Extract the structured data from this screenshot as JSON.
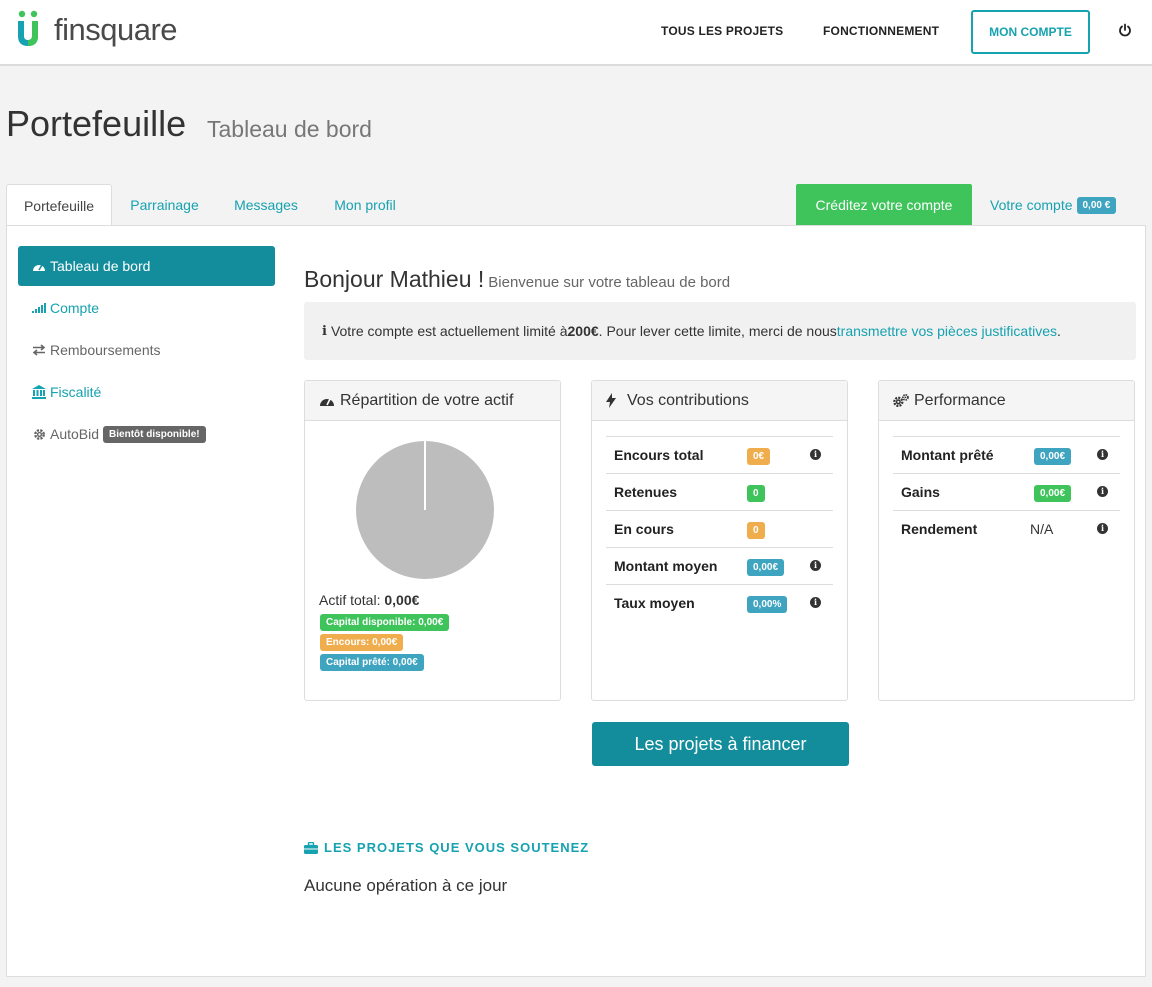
{
  "brand": {
    "name": "finsquare",
    "accent": "#16a2b0",
    "green": "#3ec45b",
    "orange": "#f0ad4e"
  },
  "nav": {
    "all_projects": "TOUS LES PROJETS",
    "how_it_works": "FONCTIONNEMENT",
    "my_account": "MON COMPTE",
    "logout_icon": "power-icon"
  },
  "page": {
    "title": "Portefeuille",
    "subtitle": "Tableau de bord"
  },
  "tabs": {
    "items": [
      {
        "label": "Portefeuille"
      },
      {
        "label": "Parrainage"
      },
      {
        "label": "Messages"
      },
      {
        "label": "Mon profil"
      }
    ],
    "credit": "Créditez votre compte",
    "account_label": "Votre compte",
    "account_balance": "0,00 €"
  },
  "sidebar": {
    "items": [
      {
        "label": "Tableau de bord",
        "icon": "dashboard-icon"
      },
      {
        "label": "Compte",
        "icon": "signal-icon"
      },
      {
        "label": "Remboursements",
        "icon": "exchange-icon"
      },
      {
        "label": "Fiscalité",
        "icon": "bank-icon"
      },
      {
        "label": "AutoBid",
        "icon": "gear-icon",
        "badge": "Bientôt disponible!"
      }
    ]
  },
  "greeting": {
    "hello": "Bonjour Mathieu !",
    "sub": "Bienvenue sur votre tableau de bord"
  },
  "alert": {
    "text_before": "Votre compte est actuellement limité à ",
    "limit": "200€",
    "text_after": ". Pour lever cette limite, merci de nous ",
    "link": "transmettre vos pièces justificatives",
    "end": "."
  },
  "repartition": {
    "title": "Répartition de votre actif",
    "actif_label": "Actif total: ",
    "actif_value": "0,00€",
    "pills": [
      {
        "label": "Capital disponible: 0,00€",
        "color": "#3ec45b"
      },
      {
        "label": "Encours: 0,00€",
        "color": "#f0ad4e"
      },
      {
        "label": "Capital prêté: 0,00€",
        "color": "#3ea4c0"
      }
    ],
    "chart_data": {
      "type": "pie",
      "values": [
        0,
        0,
        0
      ],
      "empty_color": "#bdbdbd"
    }
  },
  "contributions": {
    "title": "Vos contributions",
    "rows": [
      {
        "label": "Encours total",
        "value": "0€",
        "color": "orange"
      },
      {
        "label": "Retenues",
        "value": "0",
        "color": "green"
      },
      {
        "label": "En cours",
        "value": "0",
        "color": "orange"
      },
      {
        "label": "Montant moyen",
        "value": "0,00€",
        "color": "blue"
      },
      {
        "label": "Taux moyen",
        "value": "0,00%",
        "color": "blue"
      }
    ]
  },
  "performance": {
    "title": "Performance",
    "rows": [
      {
        "label": "Montant prêté",
        "value": "0,00€",
        "color": "blue"
      },
      {
        "label": "Gains",
        "value": "0,00€",
        "color": "green"
      },
      {
        "label": "Rendement",
        "value": "N/A",
        "color": ""
      }
    ]
  },
  "cta": "Les projets à financer",
  "supported": {
    "title": "LES PROJETS QUE VOUS SOUTENEZ",
    "empty": "Aucune opération à ce jour"
  }
}
